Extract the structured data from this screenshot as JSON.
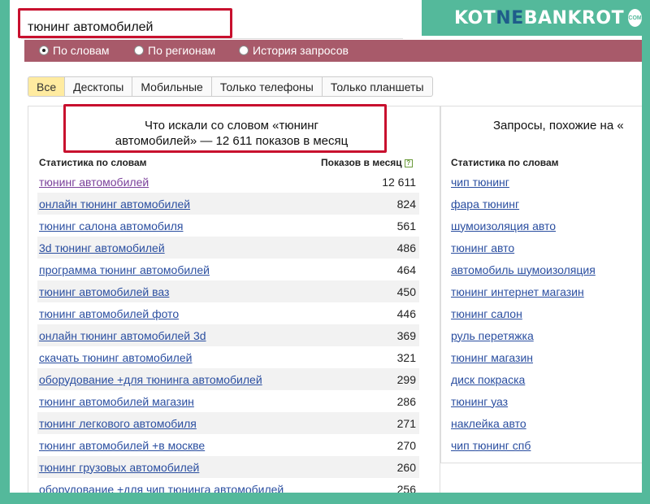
{
  "search": {
    "query": "тюнинг автомобилей"
  },
  "modes": [
    {
      "label": "По словам",
      "checked": true
    },
    {
      "label": "По регионам",
      "checked": false
    },
    {
      "label": "История запросов",
      "checked": false
    }
  ],
  "logo": {
    "part1": "KOT",
    "part2": "NE",
    "part3": "BANKROT",
    "badge": "COM"
  },
  "tabs": [
    {
      "label": "Все",
      "active": true
    },
    {
      "label": "Десктопы",
      "active": false
    },
    {
      "label": "Мобильные",
      "active": false
    },
    {
      "label": "Только телефоны",
      "active": false
    },
    {
      "label": "Только планшеты",
      "active": false
    }
  ],
  "left": {
    "title_line1": "Что искали со словом «тюнинг",
    "title_line2": "автомобилей» — 12 611 показов в месяц",
    "col_words": "Статистика по словам",
    "col_shows": "Показов в месяц",
    "help": "?",
    "rows": [
      {
        "phrase": "тюнинг автомобилей",
        "count": "12 611"
      },
      {
        "phrase": "онлайн тюнинг автомобилей",
        "count": "824"
      },
      {
        "phrase": "тюнинг салона автомобиля",
        "count": "561"
      },
      {
        "phrase": "3d тюнинг автомобилей",
        "count": "486"
      },
      {
        "phrase": "программа тюнинг автомобилей",
        "count": "464"
      },
      {
        "phrase": "тюнинг автомобилей ваз",
        "count": "450"
      },
      {
        "phrase": "тюнинг автомобилей фото",
        "count": "446"
      },
      {
        "phrase": "онлайн тюнинг автомобилей 3d",
        "count": "369"
      },
      {
        "phrase": "скачать тюнинг автомобилей",
        "count": "321"
      },
      {
        "phrase": "оборудование +для тюнинга автомобилей",
        "count": "299"
      },
      {
        "phrase": "тюнинг автомобилей магазин",
        "count": "286"
      },
      {
        "phrase": "тюнинг легкового автомобиля",
        "count": "271"
      },
      {
        "phrase": "тюнинг автомобилей +в москве",
        "count": "270"
      },
      {
        "phrase": "тюнинг грузовых автомобилей",
        "count": "260"
      },
      {
        "phrase": "оборудование +для чип тюнинга автомобилей",
        "count": "256"
      }
    ]
  },
  "right": {
    "title": "Запросы, похожие на «",
    "col_words": "Статистика по словам",
    "rows": [
      "чип тюнинг",
      "фара тюнинг",
      "шумоизоляция авто",
      "тюнинг авто",
      "автомобиль шумоизоляция",
      "тюнинг интернет магазин",
      "тюнинг салон",
      "руль перетяжка",
      "тюнинг магазин",
      "диск покраска",
      "тюнинг уаз",
      "наклейка авто",
      "чип тюнинг спб"
    ]
  }
}
